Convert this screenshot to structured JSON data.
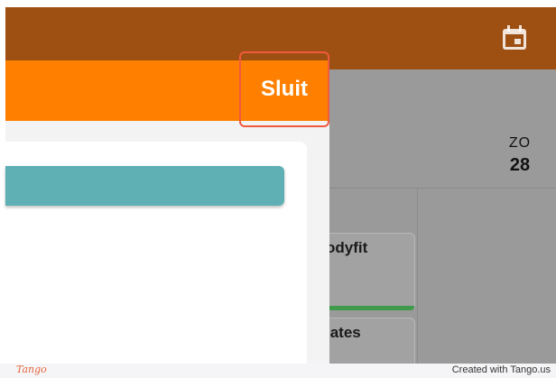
{
  "header": {
    "calendar_icon": "calendar-icon"
  },
  "calendar": {
    "day_name": "ZO",
    "day_number": "28",
    "events": [
      {
        "label": "odyfit",
        "status_color": "#3f9a4a"
      },
      {
        "label": "lates"
      }
    ]
  },
  "panel": {
    "close_label": "Sluit",
    "accent_color": "#ff8000",
    "action_button_color": "#5fb0b4"
  },
  "footer": {
    "logo": "Tango",
    "credit": "Created with Tango.us"
  }
}
